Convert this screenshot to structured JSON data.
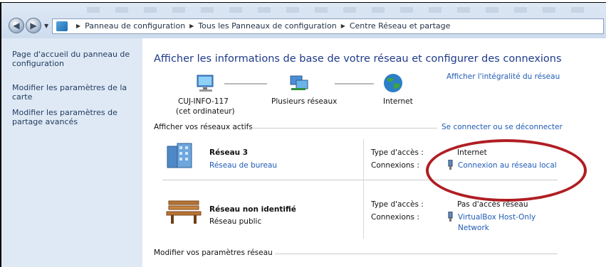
{
  "address_bar": {
    "crumbs": [
      "Panneau de configuration",
      "Tous les Panneaux de configuration",
      "Centre Réseau et partage"
    ]
  },
  "sidebar": {
    "items": [
      {
        "label": "Page d'accueil du panneau de configuration"
      },
      {
        "label": "Modifier les paramètres de la carte"
      },
      {
        "label": "Modifier les paramètres de partage avancés"
      }
    ]
  },
  "main": {
    "title": "Afficher les informations de base de votre réseau et configurer des connexions",
    "view_full_map": "Afficher l'intégralité du réseau",
    "map": {
      "computer_name": "CUJ-INFO-117",
      "computer_sub": "(cet ordinateur)",
      "multiple_networks": "Plusieurs réseaux",
      "internet": "Internet"
    },
    "active_networks_label": "Afficher vos réseaux actifs",
    "connect_disconnect": "Se connecter ou se déconnecter",
    "networks": [
      {
        "name": "Réseau  3",
        "category": "Réseau de bureau",
        "access_type_label": "Type d'accès :",
        "access_type": "Internet",
        "connections_label": "Connexions :",
        "connection": "Connexion au réseau local"
      },
      {
        "name": "Réseau non identifié",
        "category": "Réseau public",
        "access_type_label": "Type d'accès :",
        "access_type": "Pas d'accès réseau",
        "connections_label": "Connexions :",
        "connection_line1": "VirtualBox Host-Only",
        "connection_line2": "Network"
      }
    ],
    "change_settings_label": "Modifier vos paramètres réseau"
  },
  "colors": {
    "sidebar_bg": "#dfe9f5",
    "title": "#1e3a8a",
    "link": "#1f5bb5",
    "highlight_ellipse": "#b01e23"
  }
}
